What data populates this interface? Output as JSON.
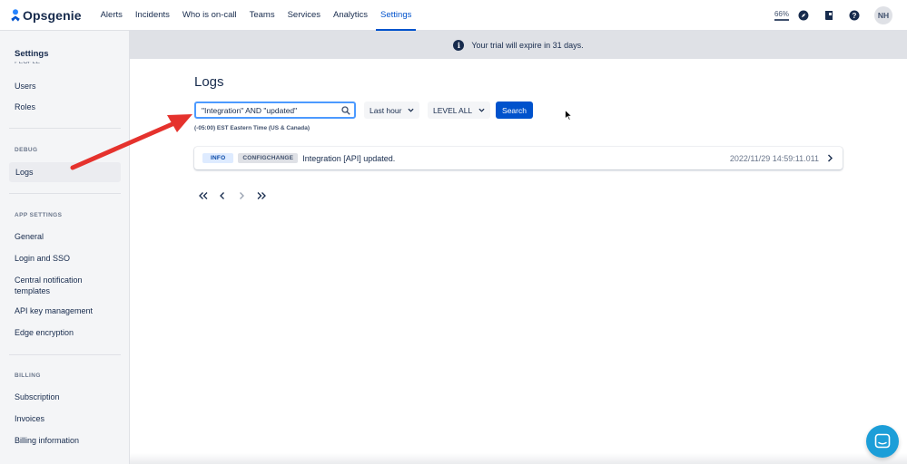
{
  "topnav": {
    "logo_text": "Opsgenie",
    "items": [
      {
        "label": "Alerts"
      },
      {
        "label": "Incidents"
      },
      {
        "label": "Who is on-call"
      },
      {
        "label": "Teams"
      },
      {
        "label": "Services"
      },
      {
        "label": "Analytics"
      },
      {
        "label": "Settings",
        "active": true
      }
    ],
    "battery_text": "66%",
    "avatar_initials": "NH"
  },
  "sidebar": {
    "title": "Settings",
    "cut_section": "PEOPLE",
    "people_items": [
      "Users",
      "Roles"
    ],
    "debug_section": "DEBUG",
    "debug_items": [
      "Logs"
    ],
    "app_settings_section": "APP SETTINGS",
    "app_settings_items": [
      "General",
      "Login and SSO",
      "Central notification templates",
      "API key management",
      "Edge encryption"
    ],
    "billing_section": "BILLING",
    "billing_items": [
      "Subscription",
      "Invoices",
      "Billing information"
    ]
  },
  "banner": {
    "text": "Your trial will expire in 31 days."
  },
  "main": {
    "title": "Logs",
    "search_value": "\"Integration\" AND \"updated\"",
    "time_range": "Last hour",
    "level": "LEVEL ALL",
    "search_button": "Search",
    "timezone_hint": "(-05:00) EST Eastern Time (US & Canada)",
    "logs": [
      {
        "level": "INFO",
        "type": "CONFIGCHANGE",
        "message": "Integration [API] updated.",
        "timestamp": "2022/11/29 14:59:11.011"
      }
    ]
  },
  "colors": {
    "brand": "#0052cc",
    "annotation_arrow": "#e5322d",
    "chat_bubble": "#1c9ed8"
  }
}
